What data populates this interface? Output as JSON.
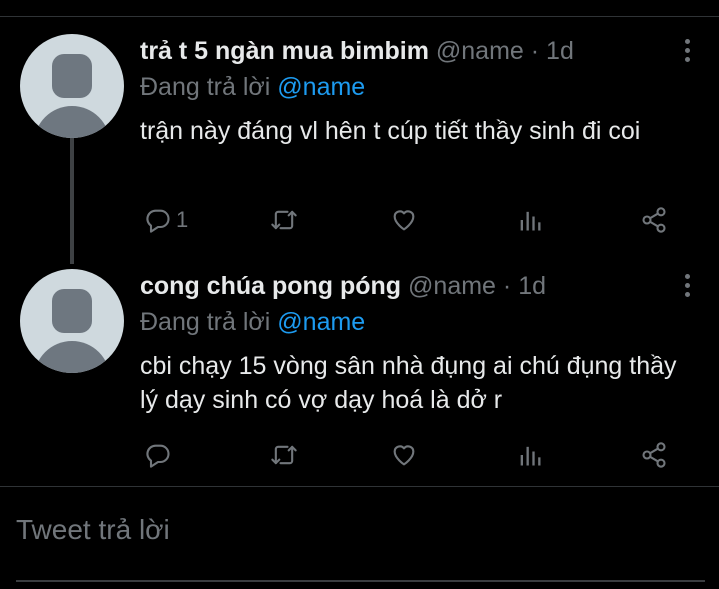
{
  "tweets": [
    {
      "name": "trả t 5 ngàn mua bimbim",
      "handle": "@name",
      "sep": "·",
      "time": "1d",
      "reply_prefix": "Đang trả lời",
      "reply_handle": "@name",
      "text": "trận này đáng vl hên t cúp tiết thầy sinh đi coi",
      "reply_count": "1"
    },
    {
      "name": "cong chúa pong póng",
      "handle": "@name",
      "sep": "·",
      "time": "1d",
      "reply_prefix": "Đang trả lời",
      "reply_handle": "@name",
      "text": "cbi chạy 15 vòng sân nhà đụng ai chú đụng thầy lý dạy sinh có vợ dạy hoá là dở r",
      "reply_count": ""
    }
  ],
  "compose": {
    "placeholder": "Tweet trả lời"
  },
  "icons": [
    "reply-icon",
    "retweet-icon",
    "like-icon",
    "analytics-icon",
    "share-icon",
    "more-icon",
    "avatar-placeholder"
  ],
  "colors": {
    "background": "#000000",
    "text": "#e7e9ea",
    "muted": "#71767b",
    "link": "#1d9bf0"
  }
}
